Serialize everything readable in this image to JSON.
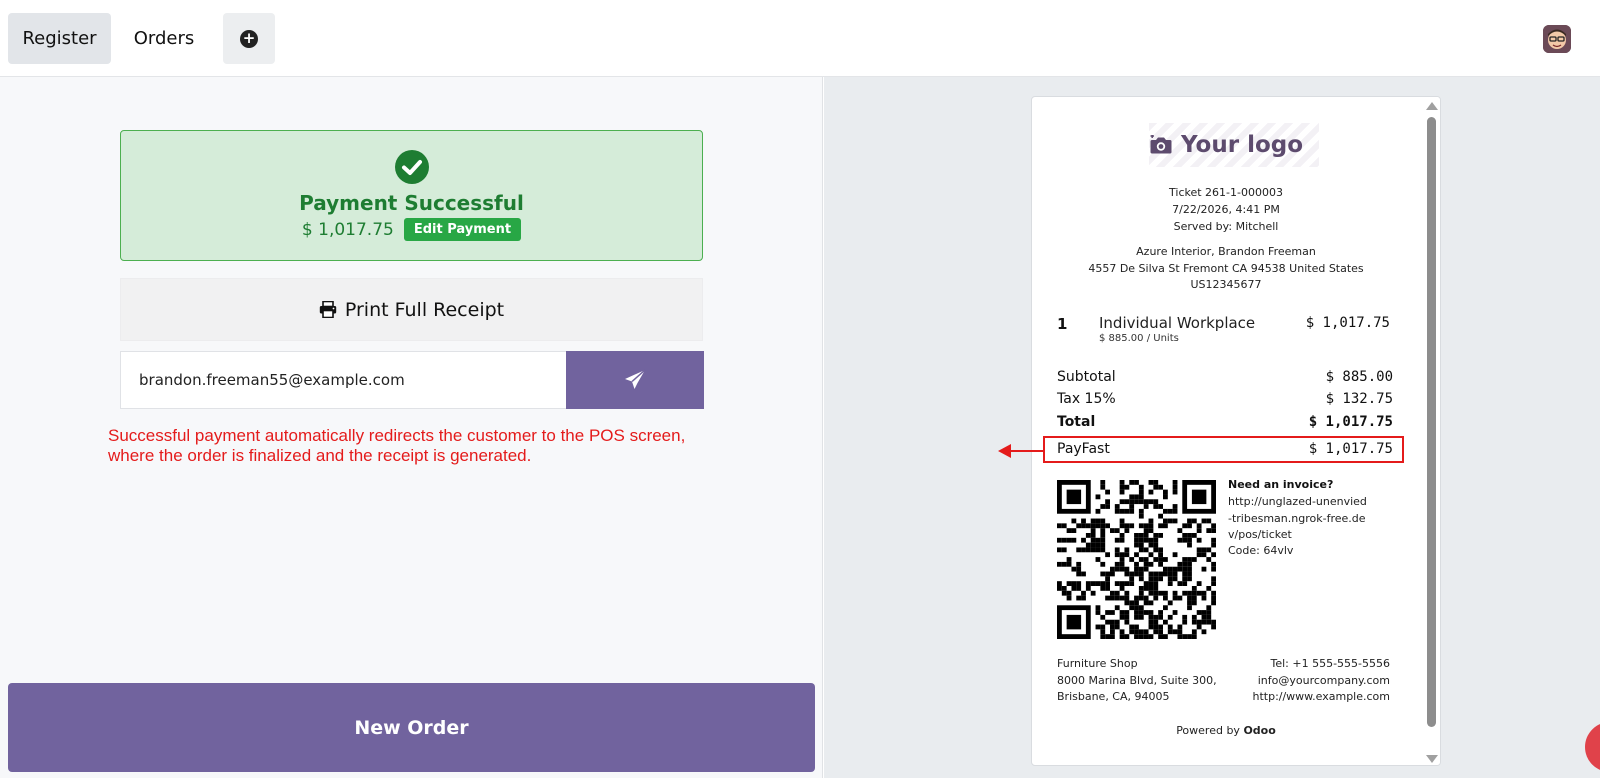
{
  "topbar": {
    "tabs": [
      {
        "label": "Register",
        "active": true
      },
      {
        "label": "Orders",
        "active": false
      }
    ],
    "add_icon": "plus-circle-icon",
    "avatar_icon": "user-avatar"
  },
  "payment": {
    "status_title": "Payment Successful",
    "amount": "$ 1,017.75",
    "edit_label": "Edit Payment",
    "print_label": "Print Full Receipt",
    "email_value": "brandon.freeman55@example.com",
    "send_icon": "paper-plane-icon",
    "new_order_label": "New Order"
  },
  "annotation": {
    "note_line1": "Successful payment automatically redirects the customer to the POS screen,",
    "note_line2": "where the order is finalized and the receipt is generated."
  },
  "receipt": {
    "logo_text": "Your logo",
    "ticket": "Ticket 261-1-000003",
    "datetime": "7/22/2026, 4:41 PM",
    "served_by": "Served by: Mitchell",
    "customer": "Azure Interior, Brandon Freeman",
    "address": "4557 De Silva St Fremont CA 94538 United States",
    "vat": "US12345677",
    "line": {
      "qty": "1",
      "name": "Individual Workplace",
      "unit_price": "$ 885.00 / Units",
      "price": "$ 1,017.75"
    },
    "subtotal_label": "Subtotal",
    "subtotal": "$ 885.00",
    "tax_label": "Tax 15%",
    "tax": "$ 132.75",
    "total_label": "Total",
    "total": "$ 1,017.75",
    "payment_label": "PayFast",
    "payment_amount": "$ 1,017.75",
    "invoice_title": "Need an invoice?",
    "invoice_url": "http://unglazed-unenvied-tribesman.ngrok-free.dev/pos/ticket",
    "invoice_code": "Code: 64vlv",
    "shop_name": "Furniture Shop",
    "shop_addr1": "8000 Marina Blvd, Suite 300,",
    "shop_addr2": "Brisbane, CA, 94005",
    "shop_phone": "Tel: +1 555-555-5556",
    "shop_email": "info@yourcompany.com",
    "shop_web": "http://www.example.com",
    "powered_prefix": "Powered by",
    "powered_brand": "Odoo"
  },
  "colors": {
    "brand_purple": "#71639e",
    "success_green": "#1e7d32",
    "annotation_red": "#e41b1b"
  }
}
